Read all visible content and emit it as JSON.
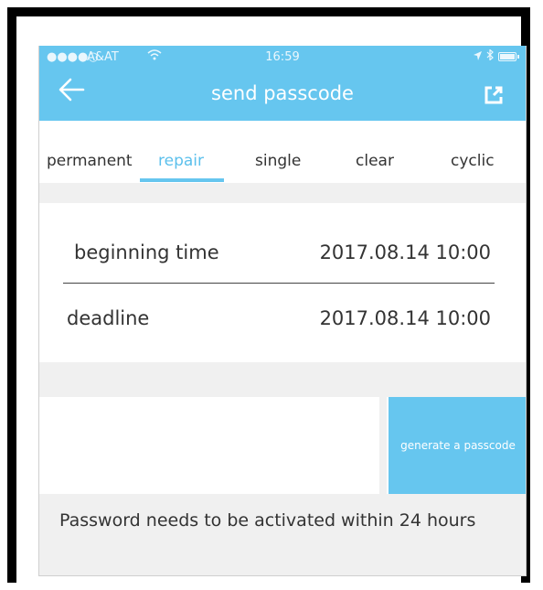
{
  "status_bar": {
    "signal": "●●●●○",
    "carrier": "A&AT",
    "time": "16:59"
  },
  "nav": {
    "title": "send passcode",
    "back_icon": "arrow-left-icon",
    "share_icon": "share-external-icon"
  },
  "tabs": [
    {
      "label": "permanent"
    },
    {
      "label": "repair"
    },
    {
      "label": "single"
    },
    {
      "label": "clear"
    },
    {
      "label": "cyclic"
    }
  ],
  "active_tab": "repair",
  "times": {
    "beginning_label": "beginning time",
    "beginning_value": "2017.08.14 10:00",
    "deadline_label": "deadline",
    "deadline_value": "2017.08.14 10:00"
  },
  "generate_button": "generate a passcode",
  "notice": "Password needs to be activated within 24 hours",
  "colors": {
    "accent": "#66c6ef",
    "background_gray": "#f0f0f0",
    "text": "#333333"
  }
}
